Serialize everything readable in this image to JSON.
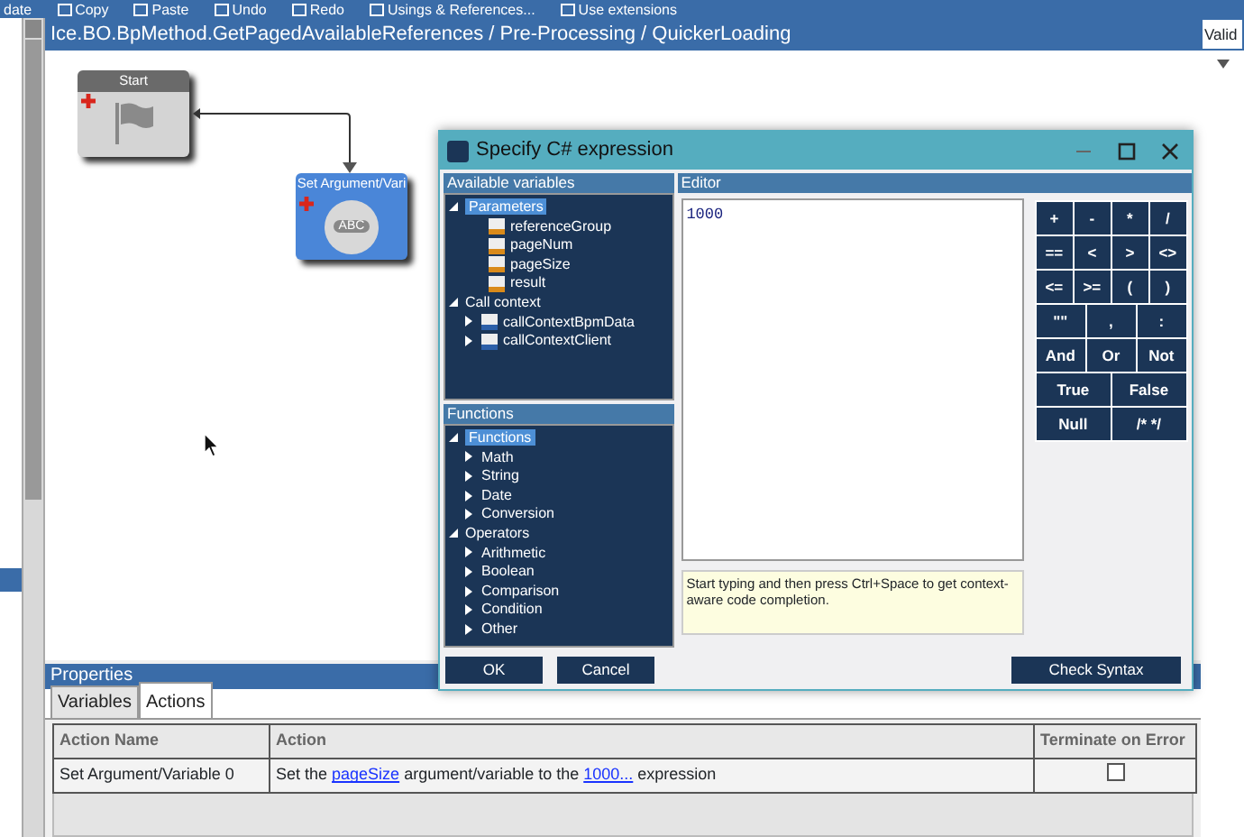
{
  "toolbar": {
    "items": [
      {
        "label": "date",
        "icon": false
      },
      {
        "label": "Copy",
        "icon": true
      },
      {
        "label": "Paste",
        "icon": true
      },
      {
        "label": "Undo",
        "icon": true
      },
      {
        "label": "Redo",
        "icon": true
      },
      {
        "label": "Usings & References...",
        "icon": true
      },
      {
        "label": "Use extensions",
        "icon": true
      }
    ]
  },
  "document": {
    "title": "Ice.BO.BpMethod.GetPagedAvailableReferences / Pre-Processing / QuickerLoading"
  },
  "right_panel": {
    "header": "Valid"
  },
  "diagram": {
    "nodes": [
      {
        "kind": "start",
        "title": "Start"
      },
      {
        "kind": "set",
        "title": "Set Argument/Vari",
        "icon_text": "ABC"
      }
    ]
  },
  "dialog": {
    "title": "Specify C# expression",
    "variables_header": "Available variables",
    "variables": [
      {
        "label": "Parameters",
        "expanded": true,
        "selected": true,
        "children": [
          {
            "label": "referenceGroup",
            "kind": "variable"
          },
          {
            "label": "pageNum",
            "kind": "variable"
          },
          {
            "label": "pageSize",
            "kind": "variable"
          },
          {
            "label": "result",
            "kind": "variable"
          }
        ]
      },
      {
        "label": "Call context",
        "expanded": true,
        "selected": false,
        "children": [
          {
            "label": "callContextBpmData",
            "kind": "dataset",
            "expanded": false
          },
          {
            "label": "callContextClient",
            "kind": "dataset",
            "expanded": false
          }
        ]
      }
    ],
    "functions_header": "Functions",
    "functions": [
      {
        "label": "Functions",
        "expanded": true,
        "selected": true,
        "children": [
          {
            "label": "Math",
            "expanded": false
          },
          {
            "label": "String",
            "expanded": false
          },
          {
            "label": "Date",
            "expanded": false
          },
          {
            "label": "Conversion",
            "expanded": false
          }
        ]
      },
      {
        "label": "Operators",
        "expanded": true,
        "selected": false,
        "children": [
          {
            "label": "Arithmetic",
            "expanded": false
          },
          {
            "label": "Boolean",
            "expanded": false
          },
          {
            "label": "Comparison",
            "expanded": false
          },
          {
            "label": "Condition",
            "expanded": false
          },
          {
            "label": "Other",
            "expanded": false
          }
        ]
      }
    ],
    "editor_header": "Editor",
    "expression": "1000",
    "hint": "Start typing and then press Ctrl+Space to get context-aware code completion.",
    "keypad": [
      [
        "+",
        "-",
        "*",
        "/"
      ],
      [
        "==",
        "<",
        ">",
        "<>"
      ],
      [
        "<=",
        ">=",
        "(",
        ")"
      ],
      [
        "\"\"",
        ",",
        ":"
      ],
      [
        "And",
        "Or",
        "Not"
      ],
      [
        "True",
        "False"
      ],
      [
        "Null",
        "/* */"
      ]
    ],
    "buttons": [
      "OK",
      "Cancel"
    ],
    "check_button": "Check Syntax"
  },
  "properties": {
    "header": "Properties",
    "tabs": [
      {
        "label": "Variables",
        "selected": false
      },
      {
        "label": "Actions",
        "selected": true
      }
    ],
    "columns": [
      "Action Name",
      "Action",
      "Terminate on Error"
    ],
    "rows": [
      {
        "name": "Set Argument/Variable 0",
        "action": [
          {
            "text": "Set the ",
            "kind": "text"
          },
          {
            "text": "pageSize",
            "kind": "link"
          },
          {
            "text": " argument/variable to the ",
            "kind": "text"
          },
          {
            "text": "1000...",
            "kind": "link"
          },
          {
            "text": " expression",
            "kind": "text"
          }
        ],
        "terminate": false
      }
    ]
  }
}
